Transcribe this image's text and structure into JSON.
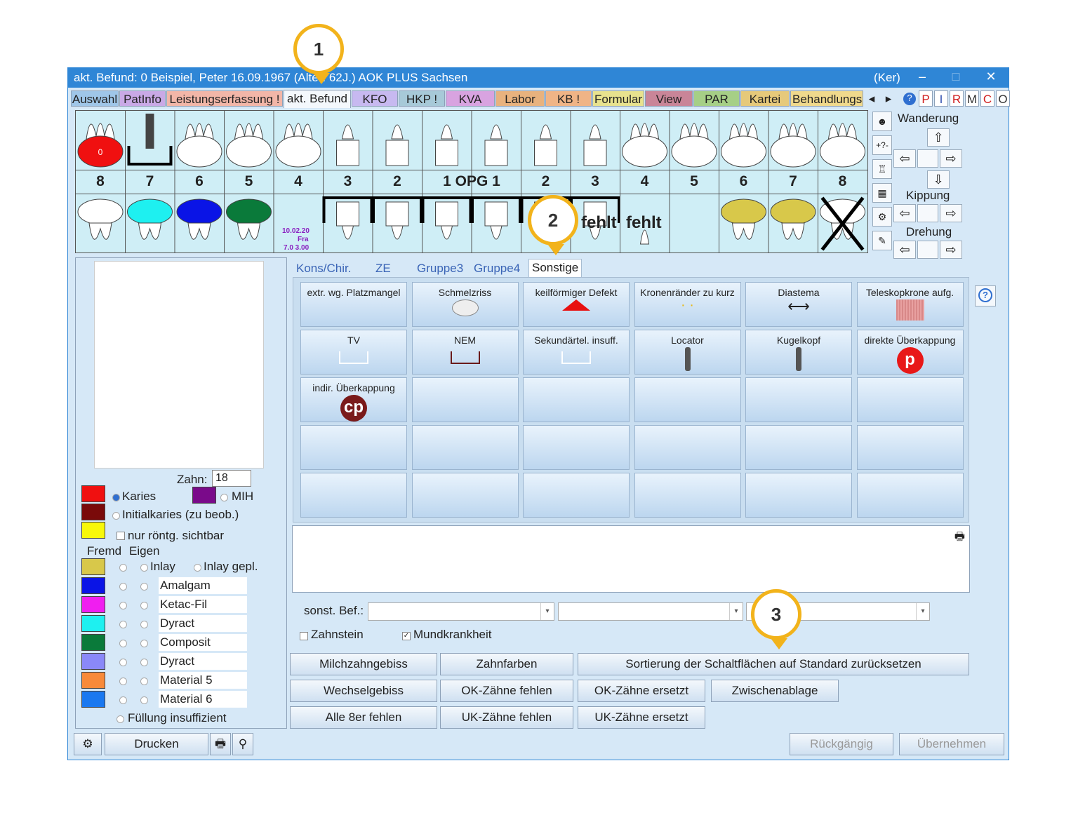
{
  "window": {
    "title": "akt. Befund: 0  Beispiel, Peter  16.09.1967 (Alter: 62J.)  AOK PLUS Sachsen",
    "user": "(Ker)",
    "minimize": "–",
    "maximize": "□",
    "close": "✕"
  },
  "tabs": [
    "Auswahl",
    "PatInfo",
    "Leistungserfassung !",
    "akt. Befund",
    "KFO",
    "HKP !",
    "KVA",
    "Labor",
    "KB !",
    "Formular",
    "View",
    "PAR",
    "Kartei",
    "Behandlungs"
  ],
  "tab_colors": [
    "#9fc6e8",
    "#c9a9e6",
    "#f2b6a8",
    "#f4f8fc",
    "#c7b9f0",
    "#a7c9d8",
    "#d8a3e0",
    "#e8b27e",
    "#f0b486",
    "#e8e28e",
    "#c98598",
    "#a6cf86",
    "#e6c97a",
    "#f0d98c"
  ],
  "tab_scroll": [
    "◂",
    "▸"
  ],
  "mini_tabs": [
    "?",
    "P",
    "I",
    "R",
    "M",
    "C",
    "O"
  ],
  "chart": {
    "upper_numbers": [
      "8",
      "7",
      "6",
      "5",
      "4",
      "3",
      "2",
      "1 OPG 1",
      "2",
      "3",
      "4",
      "5",
      "6",
      "7",
      "8"
    ],
    "lower_note_date": "10.02.20",
    "lower_note_a": "Fra",
    "lower_note_b": "7.0 3.00",
    "missing_label_1": "fehlt",
    "missing_label_2": "fehlt",
    "restoration_mark": "0"
  },
  "sidepanel": {
    "wanderung": "Wanderung",
    "kippung": "Kippung",
    "drehung": "Drehung",
    "plus_minus": "+?-"
  },
  "left": {
    "zahn_label": "Zahn:",
    "zahn_value": "18",
    "karies": "Karies",
    "mih": "MIH",
    "initialkaries": "Initialkaries (zu beob.)",
    "roentg": "nur röntg. sichtbar",
    "fremd": "Fremd",
    "eigen": "Eigen",
    "inlay": "Inlay",
    "inlay_gepl": "Inlay gepl.",
    "materials": [
      "Amalgam",
      "Ketac-Fil",
      "Dyract",
      "Composit",
      "Dyract",
      "Material 5",
      "Material 6"
    ],
    "material_colors": [
      "#d8c84a",
      "#0a14e6",
      "#f01ef0",
      "#1ef0f0",
      "#0a7a3a",
      "#8a88f8",
      "#f88a3a",
      "#1a78f0"
    ],
    "karies_colors": [
      "#f01010",
      "#7a0a0a",
      "#f8f80a",
      "#7a0a8a"
    ],
    "fuellung": "Füllung insuffizient"
  },
  "subtabs": [
    "Kons/Chir.",
    "ZE",
    "Gruppe3",
    "Gruppe4",
    "Sonstige"
  ],
  "grid_buttons": [
    {
      "label": "extr. wg. Platzmangel",
      "icon": "none"
    },
    {
      "label": "Schmelzriss",
      "icon": "crack-icon"
    },
    {
      "label": "keilförmiger Defekt",
      "icon": "red-triangle-icon"
    },
    {
      "label": "Kronenränder zu kurz",
      "icon": "dots-icon"
    },
    {
      "label": "Diastema",
      "icon": "double-arrow-icon"
    },
    {
      "label": "Teleskopkrone aufg.",
      "icon": "telescope-crown-icon"
    },
    {
      "label": "TV",
      "icon": "bracket-icon"
    },
    {
      "label": "NEM",
      "icon": "bracket-dark-icon"
    },
    {
      "label": "Sekundärtel. insuff.",
      "icon": "bracket-icon"
    },
    {
      "label": "Locator",
      "icon": "implant-icon"
    },
    {
      "label": "Kugelkopf",
      "icon": "ball-implant-icon"
    },
    {
      "label": "direkte Überkappung",
      "icon": "p-badge-icon",
      "badge": "p"
    },
    {
      "label": "indir. Überkappung",
      "icon": "cp-badge-icon",
      "badge": "cp"
    }
  ],
  "sonst": {
    "label": "sonst. Bef.:",
    "zahnstein": "Zahnstein",
    "mundkrankheit": "Mundkrankheit",
    "check": "✓"
  },
  "buttons": {
    "milchzahngebiss": "Milchzahngebiss",
    "zahnfarben": "Zahnfarben",
    "sortierung": "Sortierung der Schaltflächen auf Standard zurücksetzen",
    "wechselgebiss": "Wechselgebiss",
    "ok_fehlen": "OK-Zähne fehlen",
    "ok_ersetzt": "OK-Zähne ersetzt",
    "zwischenablage": "Zwischenablage",
    "alle8": "Alle 8er fehlen",
    "uk_fehlen": "UK-Zähne fehlen",
    "uk_ersetzt": "UK-Zähne ersetzt",
    "drucken": "Drucken",
    "rueckgaengig": "Rückgängig",
    "uebernehmen": "Übernehmen"
  },
  "callouts": [
    "1",
    "2",
    "3"
  ]
}
